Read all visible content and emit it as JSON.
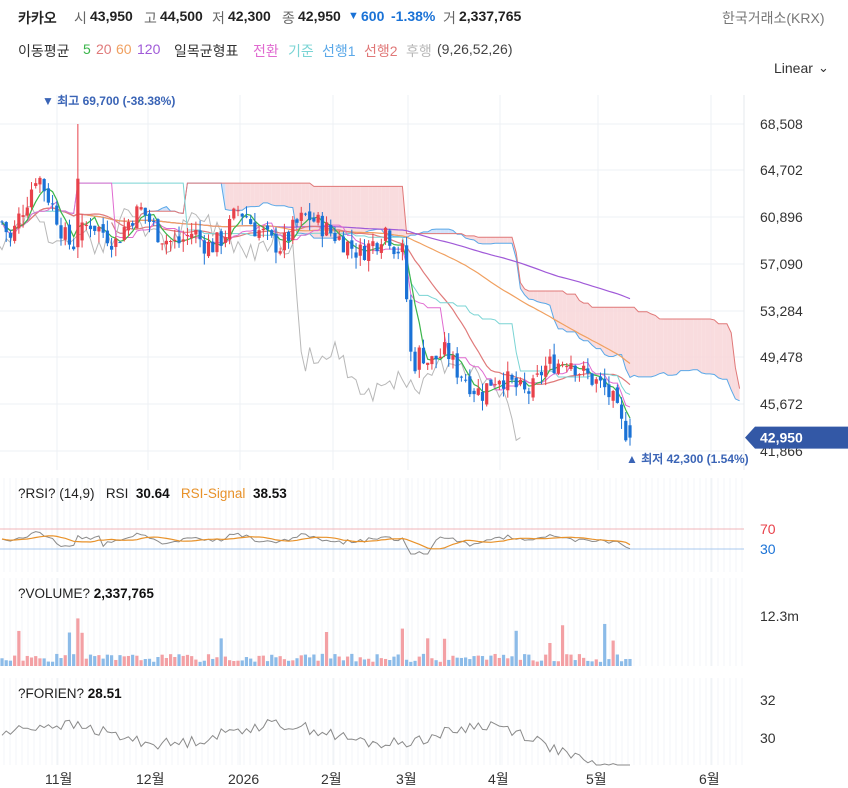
{
  "header": {
    "name": "카카오",
    "open_label": "시",
    "open": "43,950",
    "high_label": "고",
    "high": "44,500",
    "low_label": "저",
    "low": "42,300",
    "close_label": "종",
    "close": "42,950",
    "change_arrow": "▼",
    "change": "600",
    "change_pct": "-1.38%",
    "volume_label": "거",
    "volume": "2,337,765",
    "exchange": "한국거래소(KRX)"
  },
  "indicators": {
    "ma_label": "이동평균",
    "ma_periods": [
      "5",
      "20",
      "60",
      "120"
    ],
    "ichimoku_label": "일목균형표",
    "ichimoku_lines": [
      "전환",
      "기준",
      "선행1",
      "선행2",
      "후행"
    ],
    "ichimoku_params": "(9,26,52,26)",
    "scale_mode": "Linear"
  },
  "colors": {
    "up": "#e8414a",
    "down": "#1a72d6",
    "up_soft": "#f3a0a4",
    "down_soft": "#8cbbe8",
    "ma5": "#3ab54a",
    "ma20": "#e07a7a",
    "ma60": "#f0a060",
    "ma120": "#a05ad8",
    "conv": "#e06ad0",
    "base": "#7ad4d4",
    "span1": "#5aa8e8",
    "span2": "#e07878",
    "lag": "#b8b8b8",
    "rsi": "#8a8a8a",
    "rsi_signal": "#e8922a",
    "current_price_bg": "#3358a6"
  },
  "price_panel": {
    "max_marker": "▼ 최고 69,700 (-38.38%)",
    "min_marker": "▲ 최저 42,300 (1.54%)",
    "current_price": "42,950",
    "y_ticks": [
      "68,508",
      "64,702",
      "60,896",
      "57,090",
      "53,284",
      "49,478",
      "45,672",
      "41,866"
    ]
  },
  "rsi_panel": {
    "title": "?RSI? (14,9)",
    "rsi_label": "RSI",
    "rsi_value": "30.64",
    "signal_label": "RSI-Signal",
    "signal_value": "38.53",
    "y_ticks": [
      "70",
      "30"
    ]
  },
  "volume_panel": {
    "title": "?VOLUME?",
    "value": "2,337,765",
    "y_ticks": [
      "12.3m"
    ]
  },
  "forien_panel": {
    "title": "?FORIEN?",
    "value": "28.51",
    "y_ticks": [
      "32",
      "30"
    ]
  },
  "x_axis": {
    "labels": [
      "11월",
      "12월",
      "2026",
      "2월",
      "3월",
      "4월",
      "5월",
      "6월"
    ]
  },
  "chart_data": [
    {
      "type": "candlestick",
      "title": "",
      "ylim": [
        41000,
        70500
      ],
      "y_ticks": [
        68508,
        64702,
        60896,
        57090,
        53284,
        49478,
        45672,
        41866
      ],
      "x_labels": [
        "11월",
        "12월",
        "2026",
        "2월",
        "3월",
        "4월",
        "5월",
        "6월"
      ],
      "grid": true,
      "key_points": [
        {
          "label": "최고",
          "value": 69700
        },
        {
          "label": "최저",
          "value": 42300
        },
        {
          "label": "현재가",
          "value": 42950
        }
      ],
      "close_path": [
        60500,
        59000,
        61000,
        62500,
        64500,
        63000,
        61500,
        59500,
        58500,
        59500,
        60500,
        60000,
        59500,
        58800,
        60000,
        61000,
        61500,
        60500,
        59500,
        59000,
        58700,
        59200,
        59800,
        58800,
        58500,
        59000,
        60000,
        61500,
        61000,
        60000,
        59500,
        58800,
        58500,
        59500,
        60500,
        61000,
        60500,
        60000,
        59500,
        59000,
        58500,
        58000,
        58500,
        59000,
        60000,
        58500,
        58000,
        48500,
        50000,
        49000,
        49500,
        50000,
        48500,
        48000,
        47000,
        46500,
        47500,
        48000,
        47500,
        47000,
        46500,
        47000,
        48500,
        49000,
        49000,
        49500,
        48500,
        48000,
        47500,
        47000,
        46000,
        44000,
        42950
      ],
      "ichimoku_cloud": {
        "span1_end": 53500,
        "span2_end": 53800,
        "cloud_lower_end": 46500
      }
    },
    {
      "type": "line",
      "title": "?RSI? (14,9)",
      "ylim": [
        0,
        100
      ],
      "y_ticks": [
        70,
        30
      ],
      "series": [
        {
          "name": "RSI",
          "last": 30.64
        },
        {
          "name": "RSI-Signal",
          "last": 38.53
        }
      ]
    },
    {
      "type": "bar",
      "title": "?VOLUME?",
      "y_ticks": [
        "12.3m"
      ],
      "last": 2337765
    },
    {
      "type": "line",
      "title": "?FORIEN?",
      "y_ticks": [
        32,
        30
      ],
      "last": 28.51
    }
  ]
}
